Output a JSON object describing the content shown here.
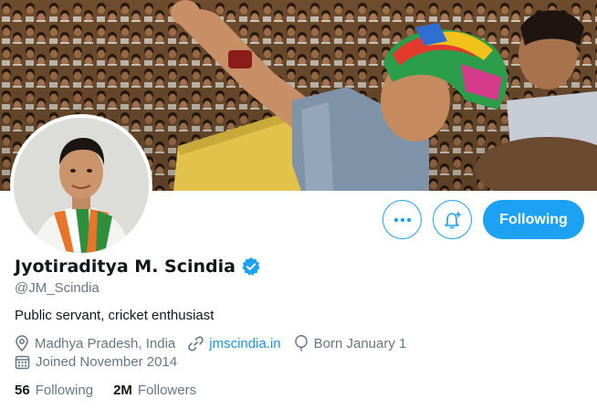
{
  "profile": {
    "name": "Jyotiraditya M. Scindia",
    "handle": "@JM_Scindia",
    "bio": "Public servant, cricket enthusiast",
    "location": "Madhya Pradesh, India",
    "website": "jmscindia.in",
    "birthday": "Born January 1",
    "joined": "Joined November 2014"
  },
  "stats": {
    "following_count": "56",
    "following_label": "Following",
    "followers_count": "2M",
    "followers_label": "Followers"
  },
  "actions": {
    "follow_label": "Following"
  },
  "icons": {
    "more": "more-icon",
    "notify": "notification-bell-icon",
    "verified": "verified-badge-icon",
    "location": "location-pin-icon",
    "link": "link-icon",
    "birthday": "balloon-icon",
    "calendar": "calendar-icon"
  },
  "colors": {
    "accent": "#1da1f2",
    "link": "#1b95e0",
    "secondary_text": "#657786",
    "primary_text": "#14171a"
  }
}
